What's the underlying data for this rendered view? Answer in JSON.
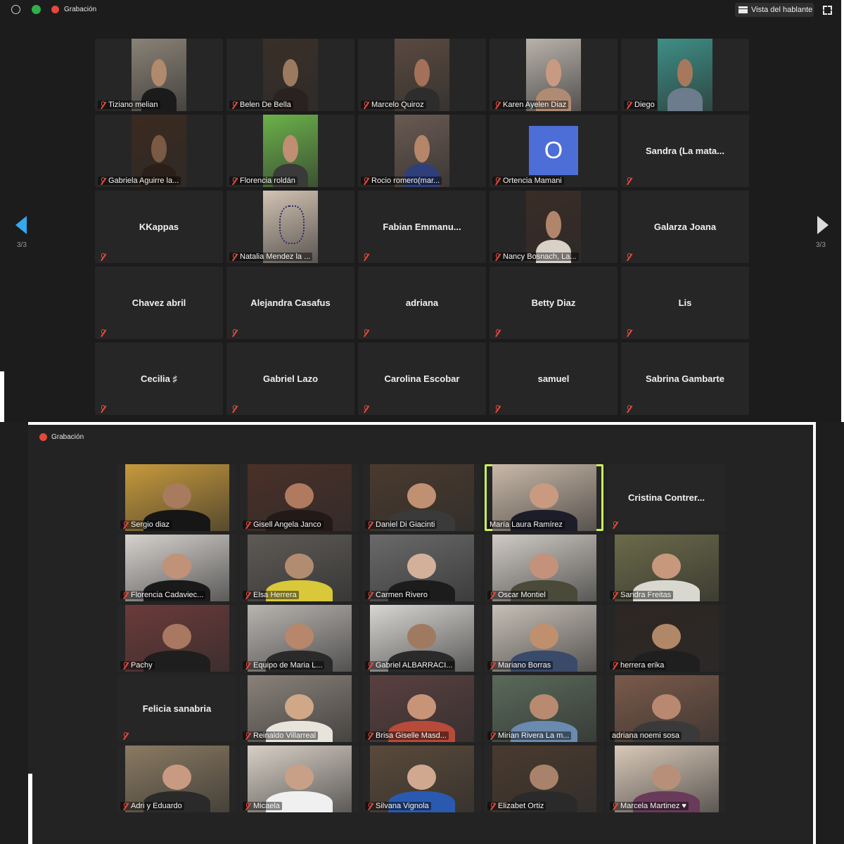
{
  "top_panel": {
    "recording_label": "Grabación",
    "speaker_view_label": "Vista del hablante",
    "page_indicator_left": "3/3",
    "page_indicator_right": "3/3",
    "participants": [
      {
        "name": "Tiziano melian",
        "video": true,
        "bg": "#8a8276",
        "skin": "#b08a6c",
        "shirt": "#1b1b1b"
      },
      {
        "name": "Belen De Bella",
        "video": true,
        "bg": "#3a2f28",
        "skin": "#9b7a60",
        "shirt": "#2a2220"
      },
      {
        "name": "Marcelo Quiroz",
        "video": true,
        "bg": "#5a4a40",
        "skin": "#a57058",
        "shirt": "#2d2d2d"
      },
      {
        "name": "Karen Ayelen Diaz",
        "video": true,
        "bg": "#b9b2aa",
        "skin": "#c99a82",
        "shirt": "#b08b74"
      },
      {
        "name": "Diego",
        "video": true,
        "bg": "#3d8f86",
        "skin": "#a8785c",
        "shirt": "#6c7c8c"
      },
      {
        "name": "Gabriela Aguirre la...",
        "video": true,
        "bg": "#3b2a1f",
        "skin": "#7a5a44",
        "shirt": "#2a2019"
      },
      {
        "name": "Florencia roldán",
        "video": true,
        "bg": "#6bb24a",
        "skin": "#c08e72",
        "shirt": "#3a3a3a"
      },
      {
        "name": "Rocio romero(mar...",
        "video": true,
        "bg": "#6a5a52",
        "skin": "#b5866a",
        "shirt": "#2f3f7a"
      },
      {
        "name": "Ortencia Mamani",
        "avatar": "O",
        "avatar_color": "#4d6ed6"
      },
      {
        "name": "Sandra  (La mata..."
      },
      {
        "name": "KKappas"
      },
      {
        "name": "Natalia Mendez la ...",
        "video": true,
        "bg": "#d2c3b3",
        "skin": "#d2c3b3",
        "shirt": "#2b2b6a",
        "tattoo": true
      },
      {
        "name": "Fabian  Emmanu..."
      },
      {
        "name": "Nancy Bosnach, La...",
        "video": true,
        "bg": "#3a2c26",
        "skin": "#b0856c",
        "shirt": "#d9d0c8"
      },
      {
        "name": "Galarza Joana"
      },
      {
        "name": "Chavez abril"
      },
      {
        "name": "Alejandra Casafus"
      },
      {
        "name": "adriana"
      },
      {
        "name": "Betty Diaz"
      },
      {
        "name": "Lis"
      },
      {
        "name": "Cecilia  ♯"
      },
      {
        "name": "Gabriel Lazo"
      },
      {
        "name": "Carolina Escobar"
      },
      {
        "name": "samuel"
      },
      {
        "name": "Sabrina Gambarte"
      }
    ]
  },
  "bottom_panel": {
    "recording_label": "Grabación",
    "participants": [
      {
        "name": "Sergio diaz",
        "video": true,
        "bg": "#c79a3c",
        "skin": "#a87a5e",
        "shirt": "#161616"
      },
      {
        "name": "Gisell Angela Janco",
        "video": true,
        "bg": "#4a3028",
        "skin": "#b07a5e",
        "shirt": "#231a18"
      },
      {
        "name": "Daniel Di Giacinti",
        "video": true,
        "bg": "#4a3a2e",
        "skin": "#c09072",
        "shirt": "#3a3a3a"
      },
      {
        "name": "María Laura Ramírez",
        "video": true,
        "bg": "#c9b9a9",
        "skin": "#c99a80",
        "shirt": "#1d1d2a",
        "active": true
      },
      {
        "name": "Cristina  Contrer..."
      },
      {
        "name": "Florencia Cadaviec...",
        "video": true,
        "bg": "#d6d2ce",
        "skin": "#c09278",
        "shirt": "#1a1a1a"
      },
      {
        "name": "Elsa Herrera",
        "video": true,
        "bg": "#5e5a56",
        "skin": "#b28c70",
        "shirt": "#d8c83a"
      },
      {
        "name": "Carmen Rivero",
        "video": true,
        "bg": "#6a6a6a",
        "skin": "#d2b09a",
        "shirt": "#1c1c1c"
      },
      {
        "name": "Oscar Montiel",
        "video": true,
        "bg": "#cfcac4",
        "skin": "#c4927a",
        "shirt": "#4a4a3a"
      },
      {
        "name": "Sandra Freitas",
        "video": true,
        "bg": "#6b6a4a",
        "skin": "#c8987c",
        "shirt": "#d8d8d0"
      },
      {
        "name": "Pachy",
        "video": true,
        "bg": "#6c3a3a",
        "skin": "#a87860",
        "shirt": "#1e1e1e"
      },
      {
        "name": "Equipo de Maria L...",
        "video": true,
        "bg": "#b8b4b0",
        "skin": "#b8866a",
        "shirt": "#2a2a2a"
      },
      {
        "name": "Gabriel ALBARRACI...",
        "video": true,
        "bg": "#d8d6d2",
        "skin": "#a07a60",
        "shirt": "#2a2a2a"
      },
      {
        "name": "Mariano Borras",
        "video": true,
        "bg": "#c6bfb6",
        "skin": "#c0906e",
        "shirt": "#3a4a6a"
      },
      {
        "name": "herrera erika",
        "video": true,
        "bg": "#2e2622",
        "skin": "#b08868",
        "shirt": "#1f1f1f"
      },
      {
        "name": "Felicia sanabria"
      },
      {
        "name": "Reinaldo Villarreal",
        "video": true,
        "bg": "#8a827a",
        "skin": "#d0a888",
        "shirt": "#e8e4dc"
      },
      {
        "name": "Brisa Giselle Masd...",
        "video": true,
        "bg": "#5a4040",
        "skin": "#c89478",
        "shirt": "#b84a3a"
      },
      {
        "name": "Mirian Rivera La m...",
        "video": true,
        "bg": "#5a6a5a",
        "skin": "#b88a70",
        "shirt": "#6a8ab0"
      },
      {
        "name": "adriana noemi sosa",
        "video": true,
        "bg": "#7a5a4a",
        "skin": "#b88870",
        "shirt": "#3a3a3a",
        "muted": false
      },
      {
        "name": "Adri y Eduardo",
        "video": true,
        "bg": "#8a7a62",
        "skin": "#c89a82",
        "shirt": "#2a2a2a"
      },
      {
        "name": "Micaela",
        "video": true,
        "bg": "#d8d0c6",
        "skin": "#c8a088",
        "shirt": "#f0f0f0"
      },
      {
        "name": "Silvana Vignola",
        "video": true,
        "bg": "#5a4a3a",
        "skin": "#d0a890",
        "shirt": "#2a5ab0"
      },
      {
        "name": "Elizabet Ortiz",
        "video": true,
        "bg": "#4a3a2e",
        "skin": "#a8826a",
        "shirt": "#2a2a2a"
      },
      {
        "name": "Marcela Martinez ♥",
        "video": true,
        "bg": "#d8c8b8",
        "skin": "#b8907a",
        "shirt": "#6a3a5a"
      }
    ]
  }
}
